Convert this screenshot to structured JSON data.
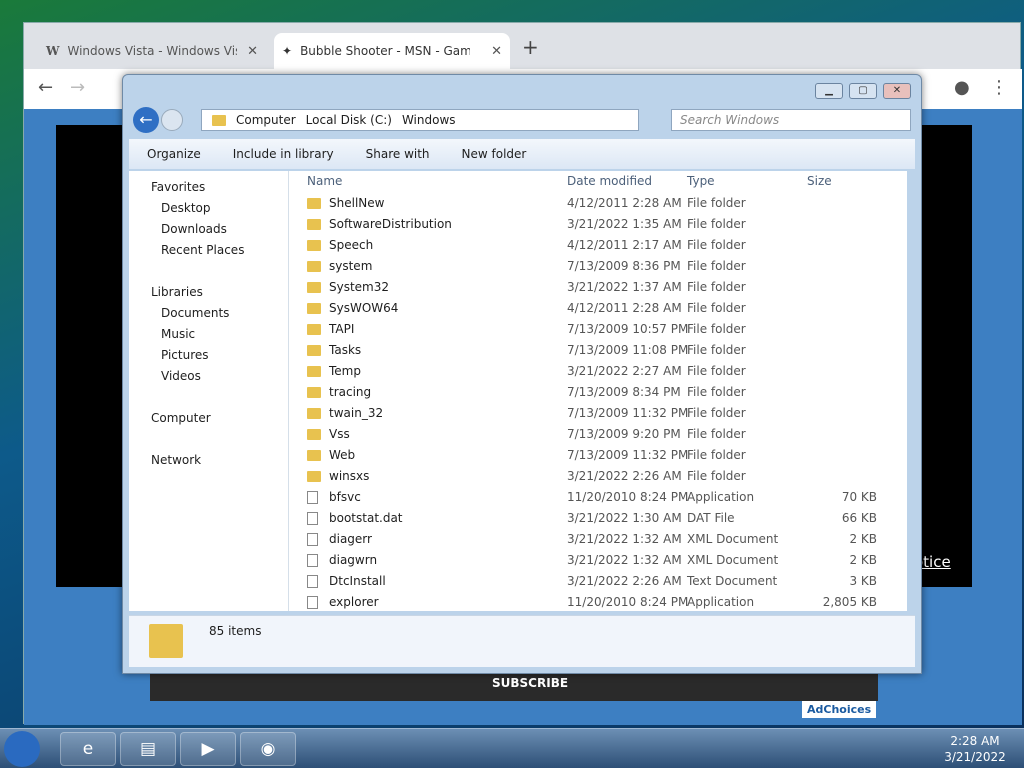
{
  "browser": {
    "tabs": [
      {
        "title": "Windows Vista - Windows Vista"
      },
      {
        "title": "Bubble Shooter - MSN - Game P"
      }
    ],
    "new_tab": "+"
  },
  "page": {
    "notice": "otice",
    "subscribe": "SUBSCRIBE",
    "adchoices": "AdChoices"
  },
  "explorer": {
    "breadcrumb": [
      "Computer",
      "Local Disk (C:)",
      "Windows"
    ],
    "search_placeholder": "Search Windows",
    "toolbar": [
      "Organize",
      "Include in library",
      "Share with",
      "New folder"
    ],
    "nav": [
      {
        "label": "Favorites"
      },
      {
        "label": "Desktop"
      },
      {
        "label": "Downloads"
      },
      {
        "label": "Recent Places"
      },
      {
        "label": "Libraries"
      },
      {
        "label": "Documents"
      },
      {
        "label": "Music"
      },
      {
        "label": "Pictures"
      },
      {
        "label": "Videos"
      },
      {
        "label": "Computer"
      },
      {
        "label": "Network"
      }
    ],
    "columns": [
      "Name",
      "Date modified",
      "Type",
      "Size"
    ],
    "files": [
      {
        "name": "ShellNew",
        "date": "4/12/2011 2:28 AM",
        "type": "File folder",
        "size": ""
      },
      {
        "name": "SoftwareDistribution",
        "date": "3/21/2022 1:35 AM",
        "type": "File folder",
        "size": ""
      },
      {
        "name": "Speech",
        "date": "4/12/2011 2:17 AM",
        "type": "File folder",
        "size": ""
      },
      {
        "name": "system",
        "date": "7/13/2009 8:36 PM",
        "type": "File folder",
        "size": ""
      },
      {
        "name": "System32",
        "date": "3/21/2022 1:37 AM",
        "type": "File folder",
        "size": ""
      },
      {
        "name": "SysWOW64",
        "date": "4/12/2011 2:28 AM",
        "type": "File folder",
        "size": ""
      },
      {
        "name": "TAPI",
        "date": "7/13/2009 10:57 PM",
        "type": "File folder",
        "size": ""
      },
      {
        "name": "Tasks",
        "date": "7/13/2009 11:08 PM",
        "type": "File folder",
        "size": ""
      },
      {
        "name": "Temp",
        "date": "3/21/2022 2:27 AM",
        "type": "File folder",
        "size": ""
      },
      {
        "name": "tracing",
        "date": "7/13/2009 8:34 PM",
        "type": "File folder",
        "size": ""
      },
      {
        "name": "twain_32",
        "date": "7/13/2009 11:32 PM",
        "type": "File folder",
        "size": ""
      },
      {
        "name": "Vss",
        "date": "7/13/2009 9:20 PM",
        "type": "File folder",
        "size": ""
      },
      {
        "name": "Web",
        "date": "7/13/2009 11:32 PM",
        "type": "File folder",
        "size": ""
      },
      {
        "name": "winsxs",
        "date": "3/21/2022 2:26 AM",
        "type": "File folder",
        "size": ""
      },
      {
        "name": "bfsvc",
        "date": "11/20/2010 8:24 PM",
        "type": "Application",
        "size": "70 KB"
      },
      {
        "name": "bootstat.dat",
        "date": "3/21/2022 1:30 AM",
        "type": "DAT File",
        "size": "66 KB"
      },
      {
        "name": "diagerr",
        "date": "3/21/2022 1:32 AM",
        "type": "XML Document",
        "size": "2 KB"
      },
      {
        "name": "diagwrn",
        "date": "3/21/2022 1:32 AM",
        "type": "XML Document",
        "size": "2 KB"
      },
      {
        "name": "DtcInstall",
        "date": "3/21/2022 2:26 AM",
        "type": "Text Document",
        "size": "3 KB"
      },
      {
        "name": "explorer",
        "date": "11/20/2010 8:24 PM",
        "type": "Application",
        "size": "2,805 KB"
      }
    ],
    "status": "85 items"
  },
  "taskbar": {
    "time": "2:28 AM",
    "date": "3/21/2022"
  }
}
